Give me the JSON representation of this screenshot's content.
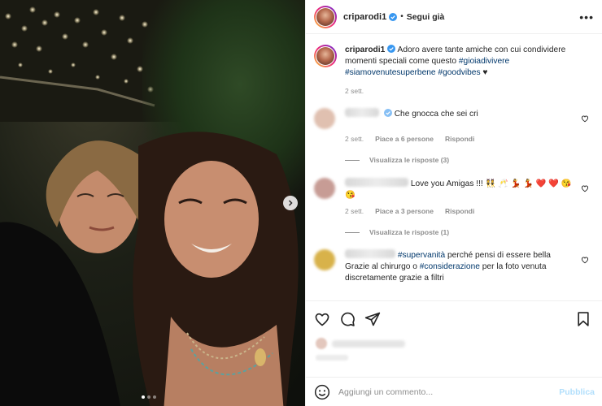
{
  "header": {
    "username": "criparodi1",
    "separator": "•",
    "follow_label": "Segui già",
    "more_icon": "more-options-icon"
  },
  "caption": {
    "username": "criparodi1",
    "text": "Adoro avere tante amiche con cui condividere momenti speciali come questo",
    "hashtags": [
      "#gioiadivivere",
      "#siamovenutesuperbene",
      "#goodvibes"
    ],
    "emoji": "♥",
    "time": "2 sett."
  },
  "comments": [
    {
      "text": "Che gnocca che sei cri",
      "time": "2 sett.",
      "likes": "Piace a 6 persone",
      "reply_label": "Rispondi",
      "replies_label": "Visualizza le risposte (3)"
    },
    {
      "text": "Love you Amigas !!! 👯 🥂 💃 💃 ❤️ ❤️ 😘 😘",
      "time": "2 sett.",
      "likes": "Piace a 3 persone",
      "reply_label": "Rispondi",
      "replies_label": "Visualizza le risposte (1)"
    },
    {
      "tag1": "#supervanità",
      "text1": " perché pensi di essere bella Grazie al chirurgo o ",
      "tag2": "#considerazione",
      "text2": " per la foto venuta discretamente grazie a filtri"
    }
  ],
  "add_comment": {
    "placeholder": "Aggiungi un commento...",
    "publish_label": "Pubblica"
  },
  "colors": {
    "link": "#00376b",
    "muted": "#8e8e8e",
    "publish": "#b2dffc"
  }
}
